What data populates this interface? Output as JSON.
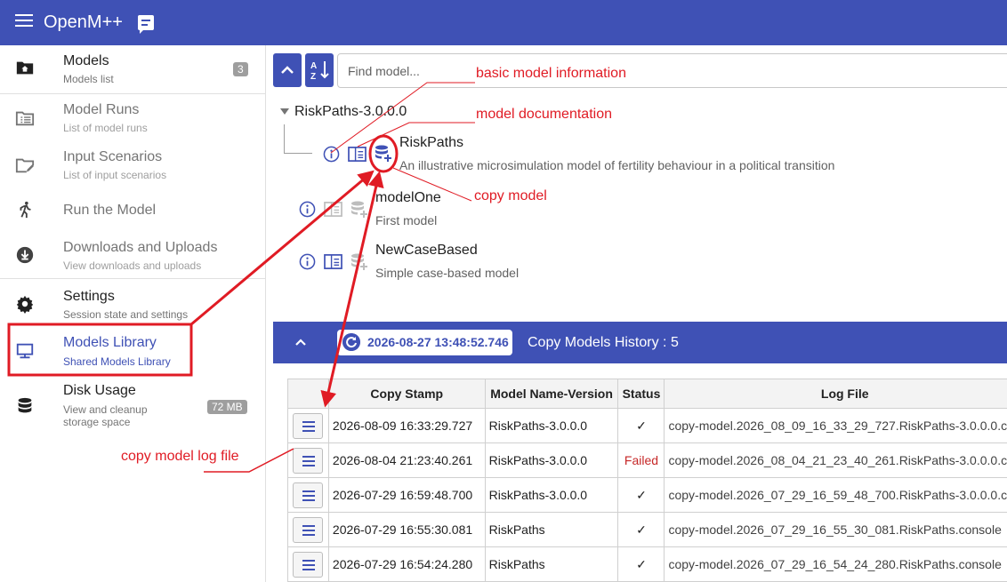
{
  "app": {
    "title": "OpenM++"
  },
  "sidebar": {
    "items": [
      {
        "title": "Models",
        "subtitle": "Models list",
        "badge": "3"
      },
      {
        "title": "Model Runs",
        "subtitle": "List of model runs"
      },
      {
        "title": "Input Scenarios",
        "subtitle": "List of input scenarios"
      },
      {
        "title": "Run the Model"
      },
      {
        "title": "Downloads and Uploads",
        "subtitle": "View downloads and uploads"
      },
      {
        "title": "Settings",
        "subtitle": "Session state and settings"
      },
      {
        "title": "Models Library",
        "subtitle": "Shared Models Library"
      },
      {
        "title": "Disk Usage",
        "subtitle_line1": "View and cleanup",
        "subtitle_line2": "storage space",
        "badge": "72 MB"
      }
    ]
  },
  "search": {
    "placeholder": "Find model..."
  },
  "tree": {
    "root": "RiskPaths-3.0.0.0",
    "models": [
      {
        "name": "RiskPaths",
        "description": "An illustrative microsimulation model of fertility behaviour in a political transition"
      },
      {
        "name": "modelOne",
        "description": "First model"
      },
      {
        "name": "NewCaseBased",
        "description": "Simple case-based model"
      }
    ]
  },
  "history": {
    "stamp": "2026-08-27 13:48:52.746",
    "title": "Copy Models History : 5",
    "columns": [
      "",
      "Copy Stamp",
      "Model Name-Version",
      "Status",
      "Log File"
    ],
    "rows": [
      {
        "stamp": "2026-08-09 16:33:29.727",
        "model": "RiskPaths-3.0.0.0",
        "status": "✓",
        "log": "copy-model.2026_08_09_16_33_29_727.RiskPaths-3.0.0.0.c"
      },
      {
        "stamp": "2026-08-04 21:23:40.261",
        "model": "RiskPaths-3.0.0.0",
        "status": "Failed",
        "log": "copy-model.2026_08_04_21_23_40_261.RiskPaths-3.0.0.0.c"
      },
      {
        "stamp": "2026-07-29 16:59:48.700",
        "model": "RiskPaths-3.0.0.0",
        "status": "✓",
        "log": "copy-model.2026_07_29_16_59_48_700.RiskPaths-3.0.0.0.c"
      },
      {
        "stamp": "2026-07-29 16:55:30.081",
        "model": "RiskPaths",
        "status": "✓",
        "log": "copy-model.2026_07_29_16_55_30_081.RiskPaths.console"
      },
      {
        "stamp": "2026-07-29 16:54:24.280",
        "model": "RiskPaths",
        "status": "✓",
        "log": "copy-model.2026_07_29_16_54_24_280.RiskPaths.console"
      }
    ]
  },
  "annotations": {
    "basic_info": "basic model information",
    "documentation": "model documentation",
    "copy_model": "copy model",
    "copy_log": "copy model log file"
  },
  "colors": {
    "primary": "#3f51b5",
    "annotation": "#e01b24",
    "failed": "#c62828"
  },
  "icons": [
    "menu-icon",
    "message-icon",
    "folder-home-icon",
    "table-list-icon",
    "folder-edit-icon",
    "run-icon",
    "download-icon",
    "gear-icon",
    "monitor-icon",
    "database-icon",
    "chevron-up-icon",
    "sort-az-icon",
    "info-icon",
    "book-icon",
    "database-plus-icon",
    "refresh-icon",
    "log-lines-icon"
  ]
}
